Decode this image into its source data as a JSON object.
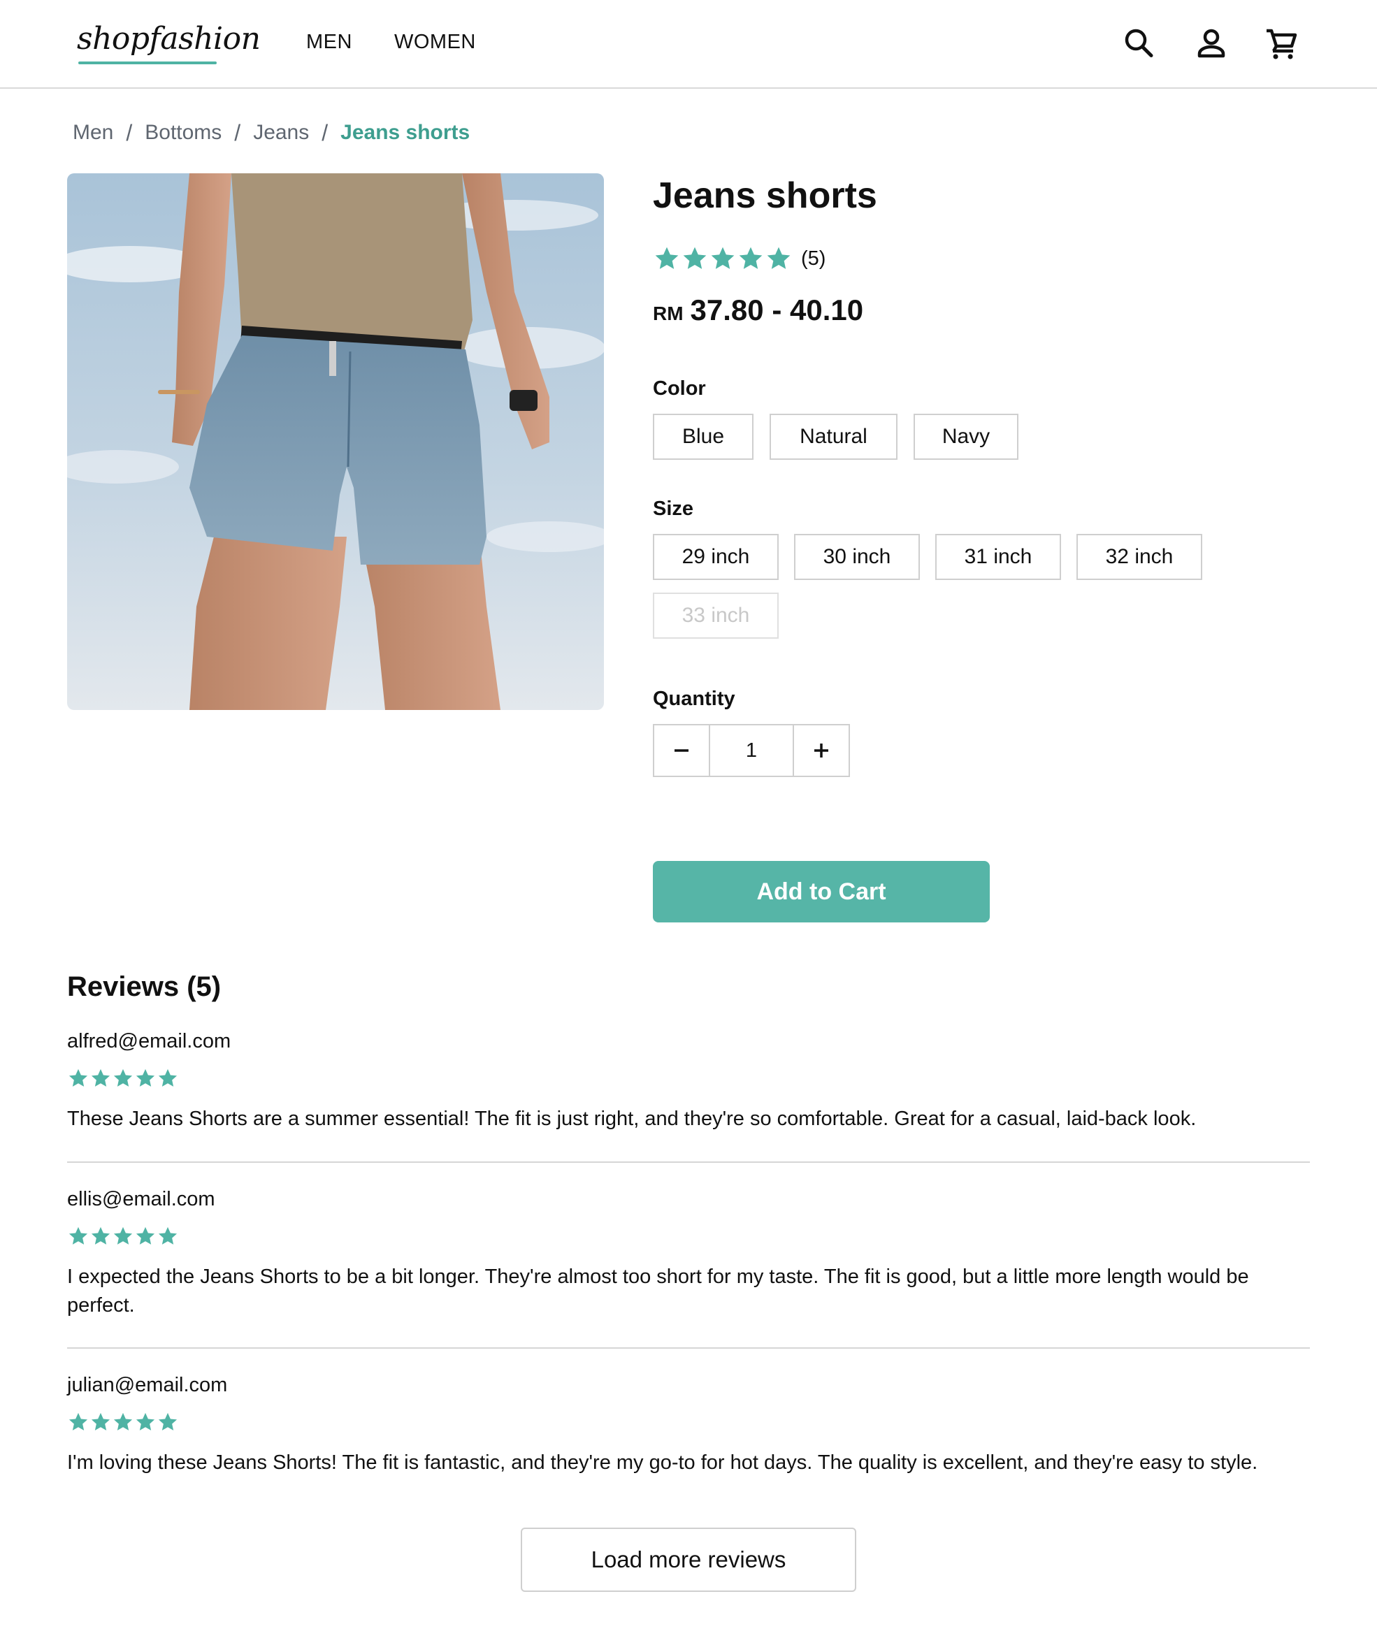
{
  "header": {
    "logo": "shopfashion",
    "nav": [
      {
        "label": "MEN"
      },
      {
        "label": "WOMEN"
      }
    ],
    "icons": [
      "search-icon",
      "user-icon",
      "cart-icon"
    ]
  },
  "breadcrumb": [
    "Men",
    "Bottoms",
    "Jeans",
    "Jeans shorts"
  ],
  "product": {
    "title": "Jeans shorts",
    "rating": 5,
    "rating_count": "(5)",
    "price_currency": "RM",
    "price_range": "37.80 - 40.10",
    "color_label": "Color",
    "colors": [
      "Blue",
      "Natural",
      "Navy"
    ],
    "size_label": "Size",
    "sizes": [
      {
        "label": "29 inch",
        "available": true
      },
      {
        "label": "30 inch",
        "available": true
      },
      {
        "label": "31 inch",
        "available": true
      },
      {
        "label": "32 inch",
        "available": true
      },
      {
        "label": "33 inch",
        "available": false
      }
    ],
    "quantity_label": "Quantity",
    "quantity": "1",
    "add_to_cart": "Add to Cart"
  },
  "reviews": {
    "title": "Reviews (5)",
    "items": [
      {
        "email": "alfred@email.com",
        "stars": 5,
        "text": "These Jeans Shorts are a summer essential! The fit is just right, and they're so comfortable. Great for a casual, laid-back look."
      },
      {
        "email": "ellis@email.com",
        "stars": 5,
        "text": "I expected the Jeans Shorts to be a bit longer. They're almost too short for my taste. The fit is good, but a little more length would be perfect."
      },
      {
        "email": "julian@email.com",
        "stars": 5,
        "text": "I'm loving these Jeans Shorts! The fit is fantastic, and they're my go-to for hot days. The quality is excellent, and they're easy to style."
      }
    ],
    "load_more": "Load more reviews"
  },
  "colors": {
    "accent": "#56b5a7",
    "accent_text": "#3e9e8f",
    "star": "#4fb3a4"
  }
}
